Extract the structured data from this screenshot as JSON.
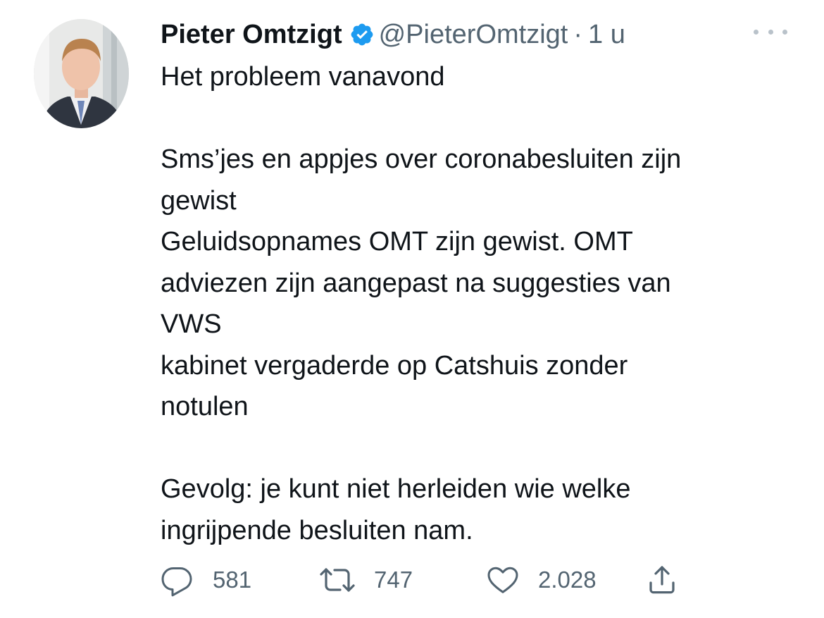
{
  "author": {
    "name": "Pieter Omtzigt",
    "handle": "@PieterOmtzigt",
    "separator": "·",
    "time": "1 u",
    "verified_icon": "verified-badge-icon",
    "verified_color": "#1d9bf0"
  },
  "tweet": {
    "lines": [
      "Het probleem vanavond",
      "",
      "Sms’jes en appjes over coronabesluiten zijn",
      "gewist",
      "Geluidsopnames OMT zijn gewist. OMT",
      "adviezen zijn aangepast na suggesties van",
      "VWS",
      "kabinet vergaderde op Catshuis zonder",
      "notulen",
      "",
      "Gevolg: je kunt niet herleiden wie welke",
      "ingrijpende besluiten nam."
    ]
  },
  "actions": {
    "reply": {
      "icon": "reply-icon",
      "count": "581"
    },
    "retweet": {
      "icon": "retweet-icon",
      "count": "747"
    },
    "like": {
      "icon": "heart-icon",
      "count": "2.028"
    },
    "share": {
      "icon": "share-icon"
    }
  },
  "colors": {
    "text": "#0f1419",
    "secondary": "#536471",
    "accent": "#1d9bf0"
  }
}
